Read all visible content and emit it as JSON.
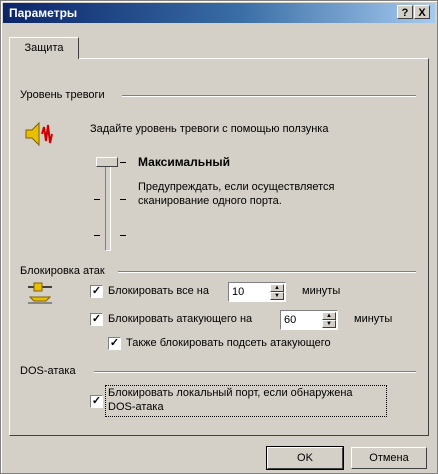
{
  "window": {
    "title": "Параметры",
    "help_label": "?",
    "close_label": "X"
  },
  "tabs": [
    {
      "label": "Защита",
      "selected": true
    }
  ],
  "alert_level": {
    "group_label": "Уровень тревоги",
    "hint": "Задайте уровень тревоги с помощью ползунка",
    "icon": "speaker-alert-icon",
    "level_name": "Максимальный",
    "description_line1": "Предупреждать, если осуществляется",
    "description_line2": "сканирование одного порта.",
    "slider_position": "top"
  },
  "attack_blocking": {
    "group_label": "Блокировка атак",
    "icon": "block-attack-icon",
    "block_all": {
      "checked": true,
      "label": "Блокировать все на",
      "value": "10",
      "unit": "минуты"
    },
    "block_attacker": {
      "checked": true,
      "label": "Блокировать атакующего на",
      "value": "60",
      "unit": "минуты"
    },
    "block_subnet": {
      "checked": true,
      "label": "Также блокировать подсеть атакующего"
    }
  },
  "dos_attack": {
    "group_label": "DOS-атака",
    "block_port": {
      "checked": true,
      "label_line1": "Блокировать локальный порт, если обнаружена",
      "label_line2": "DOS-атака"
    }
  },
  "footer": {
    "ok_label": "OK",
    "cancel_label": "Отмена"
  },
  "colors": {
    "titlebar_start": "#0a246a",
    "titlebar_end": "#a6caf0",
    "face": "#d4d0c8"
  }
}
